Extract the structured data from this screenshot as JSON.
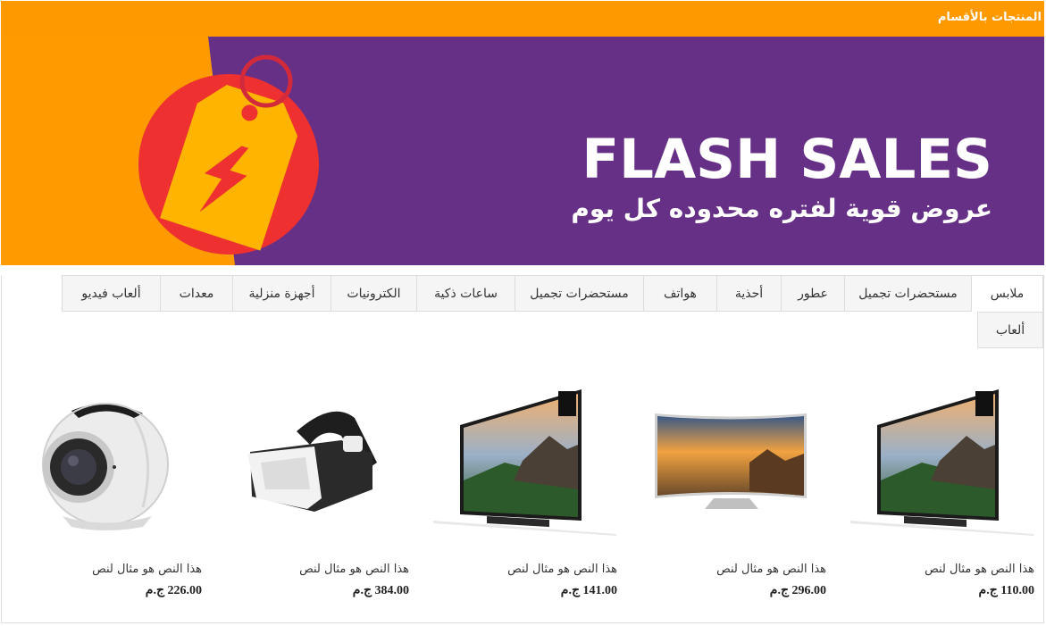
{
  "header": {
    "title": "المنتجات بالأقسام"
  },
  "banner": {
    "title": "FLASH SALES",
    "subtitle": "عروض قوية لفتره محدوده كل يوم",
    "colors": {
      "orange": "#ff9a00",
      "purple": "#663087",
      "red": "#ef3030",
      "tag": "#ffb400"
    },
    "icon": "flash-sale-tag-icon"
  },
  "tabs": [
    {
      "label": "ملابس",
      "active": true
    },
    {
      "label": "مستحضرات تجميل"
    },
    {
      "label": "عطور"
    },
    {
      "label": "أحذية"
    },
    {
      "label": "هواتف"
    },
    {
      "label": "مستحضرات تجميل"
    },
    {
      "label": "ساعات ذكية"
    },
    {
      "label": "الكترونيات"
    },
    {
      "label": "أجهزة منزلية"
    },
    {
      "label": "معدات"
    },
    {
      "label": "ألعاب فيديو"
    },
    {
      "label": "ألعاب"
    }
  ],
  "products": [
    {
      "name": "هذا النص هو مثال لنص",
      "price": "110.00 ج.م",
      "image": "4k-tv-image"
    },
    {
      "name": "هذا النص هو مثال لنص",
      "price": "296.00 ج.م",
      "image": "curved-tv-image"
    },
    {
      "name": "هذا النص هو مثال لنص",
      "price": "141.00 ج.م",
      "image": "4k-tv-image"
    },
    {
      "name": "هذا النص هو مثال لنص",
      "price": "384.00 ج.م",
      "image": "vr-headset-image"
    },
    {
      "name": "هذا النص هو مثال لنص",
      "price": "226.00 ج.م",
      "image": "360-camera-image"
    }
  ]
}
